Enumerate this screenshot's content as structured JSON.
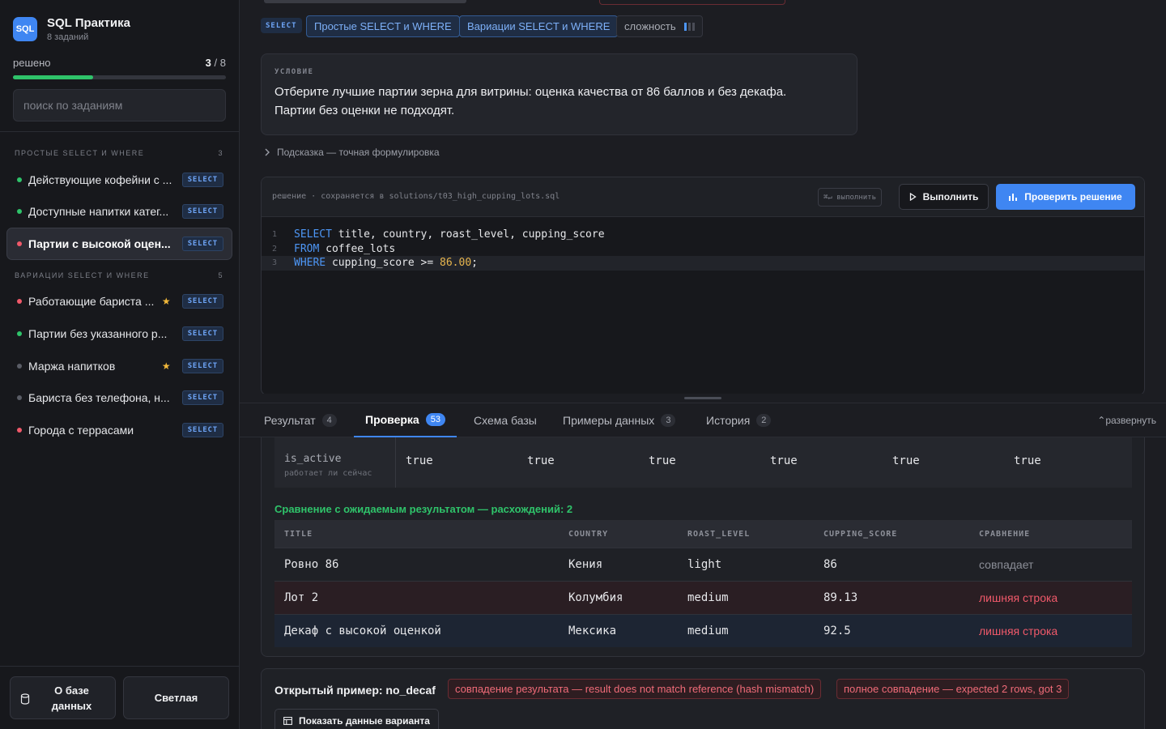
{
  "brand": {
    "logo": "SQL",
    "title": "SQL Практика",
    "subtitle": "8 заданий"
  },
  "progress": {
    "label": "решено",
    "solved": "3",
    "total": "/ 8",
    "fraction": 0.375
  },
  "search": {
    "placeholder": "поиск по заданиям"
  },
  "groups": [
    {
      "title": "простые SELECT и WHERE",
      "count": "3"
    },
    {
      "title": "вариации SELECT и WHERE",
      "count": "5"
    }
  ],
  "tasks": [
    {
      "label": "Действующие кофейни с ...",
      "status": "solved",
      "tag": "SELECT",
      "star": false
    },
    {
      "label": "Доступные напитки катег...",
      "status": "solved",
      "tag": "SELECT",
      "star": false
    },
    {
      "label": "Партии с высокой оцен...",
      "status": "failed",
      "tag": "SELECT",
      "star": false
    },
    {
      "label": "Работающие бариста ...",
      "status": "failed",
      "tag": "SELECT",
      "star": true
    },
    {
      "label": "Партии без указанного р...",
      "status": "solved",
      "tag": "SELECT",
      "star": false
    },
    {
      "label": "Маржа напитков",
      "status": "todo",
      "tag": "SELECT",
      "star": true
    },
    {
      "label": "Бариста без телефона, н...",
      "status": "todo",
      "tag": "SELECT",
      "star": false
    },
    {
      "label": "Города с террасами",
      "status": "failed",
      "tag": "SELECT",
      "star": false
    }
  ],
  "footer": {
    "db_label": "О базе данных",
    "theme_label": "Светлая"
  },
  "pills": {
    "select": "SELECT",
    "topic1": "Простые SELECT и WHERE",
    "topic2": "Вариации SELECT и WHERE",
    "difficulty": "сложность"
  },
  "condition": {
    "label": "УСЛОВИЕ",
    "line1": "Отберите лучшие партии зерна для витрины: оценка качества от 86 баллов и без декафа.",
    "line2": "Партии без оценки не подходят."
  },
  "hint": "Подсказка — точная формулировка",
  "editor": {
    "info": "решение · сохраняется в solutions/t03_high_cupping_lots.sql",
    "shortcut": "⌘↵ выполнить",
    "run_label": "Выполнить",
    "check_label": "Проверить решение",
    "lines": [
      {
        "n": "1",
        "kw": "SELECT",
        "rest": " title, country, roast_level, cupping_score",
        "num": "",
        "tail": ""
      },
      {
        "n": "2",
        "kw": "FROM",
        "rest": " coffee_lots",
        "num": "",
        "tail": ""
      },
      {
        "n": "3",
        "kw": "WHERE",
        "rest": " cupping_score >= ",
        "num": "86.00",
        "tail": ";"
      }
    ]
  },
  "tabs": [
    {
      "label": "Результат",
      "count": "4"
    },
    {
      "label": "Проверка",
      "count": "53"
    },
    {
      "label": "Схема базы",
      "count": ""
    },
    {
      "label": "Примеры данных",
      "count": "3"
    },
    {
      "label": "История",
      "count": "2"
    }
  ],
  "expand_label": "развернуть",
  "variant_row": {
    "name": "is_active",
    "desc": "работает ли сейчас",
    "values": [
      "true",
      "true",
      "true",
      "true",
      "true",
      "true"
    ]
  },
  "comparison": {
    "title": "Сравнение с ожидаемым результатом — расхождений: 2",
    "columns": [
      "TITLE",
      "COUNTRY",
      "ROAST_LEVEL",
      "CUPPING_SCORE",
      "СРАВНЕНИЕ"
    ],
    "rows": [
      {
        "title": "Ровно 86",
        "country": "Кения",
        "roast": "light",
        "score": "86",
        "result": "совпадает",
        "kind": "match"
      },
      {
        "title": "Лот 2",
        "country": "Колумбия",
        "roast": "medium",
        "score": "89.13",
        "result": "лишняя строка",
        "kind": "extra"
      },
      {
        "title": "Декаф с высокой оценкой",
        "country": "Мексика",
        "roast": "medium",
        "score": "92.5",
        "result": "лишняя строка",
        "kind": "extra"
      }
    ]
  },
  "open_example": {
    "title": "Открытый пример: no_decaf",
    "error1": "совпадение результата — result does not match reference (hash mismatch)",
    "error2": "полное совпадение — expected 2 rows, got 3",
    "show_label": "Показать данные варианта"
  },
  "colors": {
    "accent": "#3f86f2",
    "success": "#2fc36a",
    "danger": "#f0596a",
    "star": "#f1b83a"
  }
}
